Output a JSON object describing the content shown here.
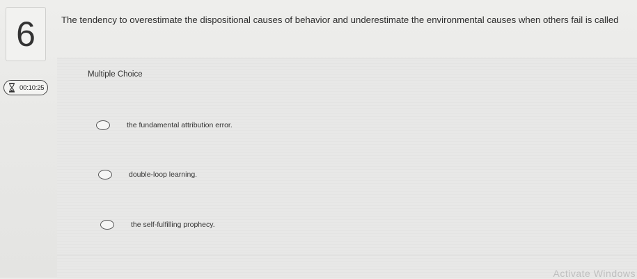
{
  "question": {
    "number": "6",
    "text": "The tendency to overestimate the dispositional causes of behavior and underestimate the environmental causes when others fail is called"
  },
  "timer": {
    "icon": "hourglass-icon",
    "value": "00:10:25"
  },
  "answer_panel": {
    "type_label": "Multiple Choice",
    "options": [
      {
        "label": "the fundamental attribution error."
      },
      {
        "label": "double-loop learning."
      },
      {
        "label": "the self-fulfilling prophecy."
      }
    ]
  },
  "watermark": "Activate Windows"
}
